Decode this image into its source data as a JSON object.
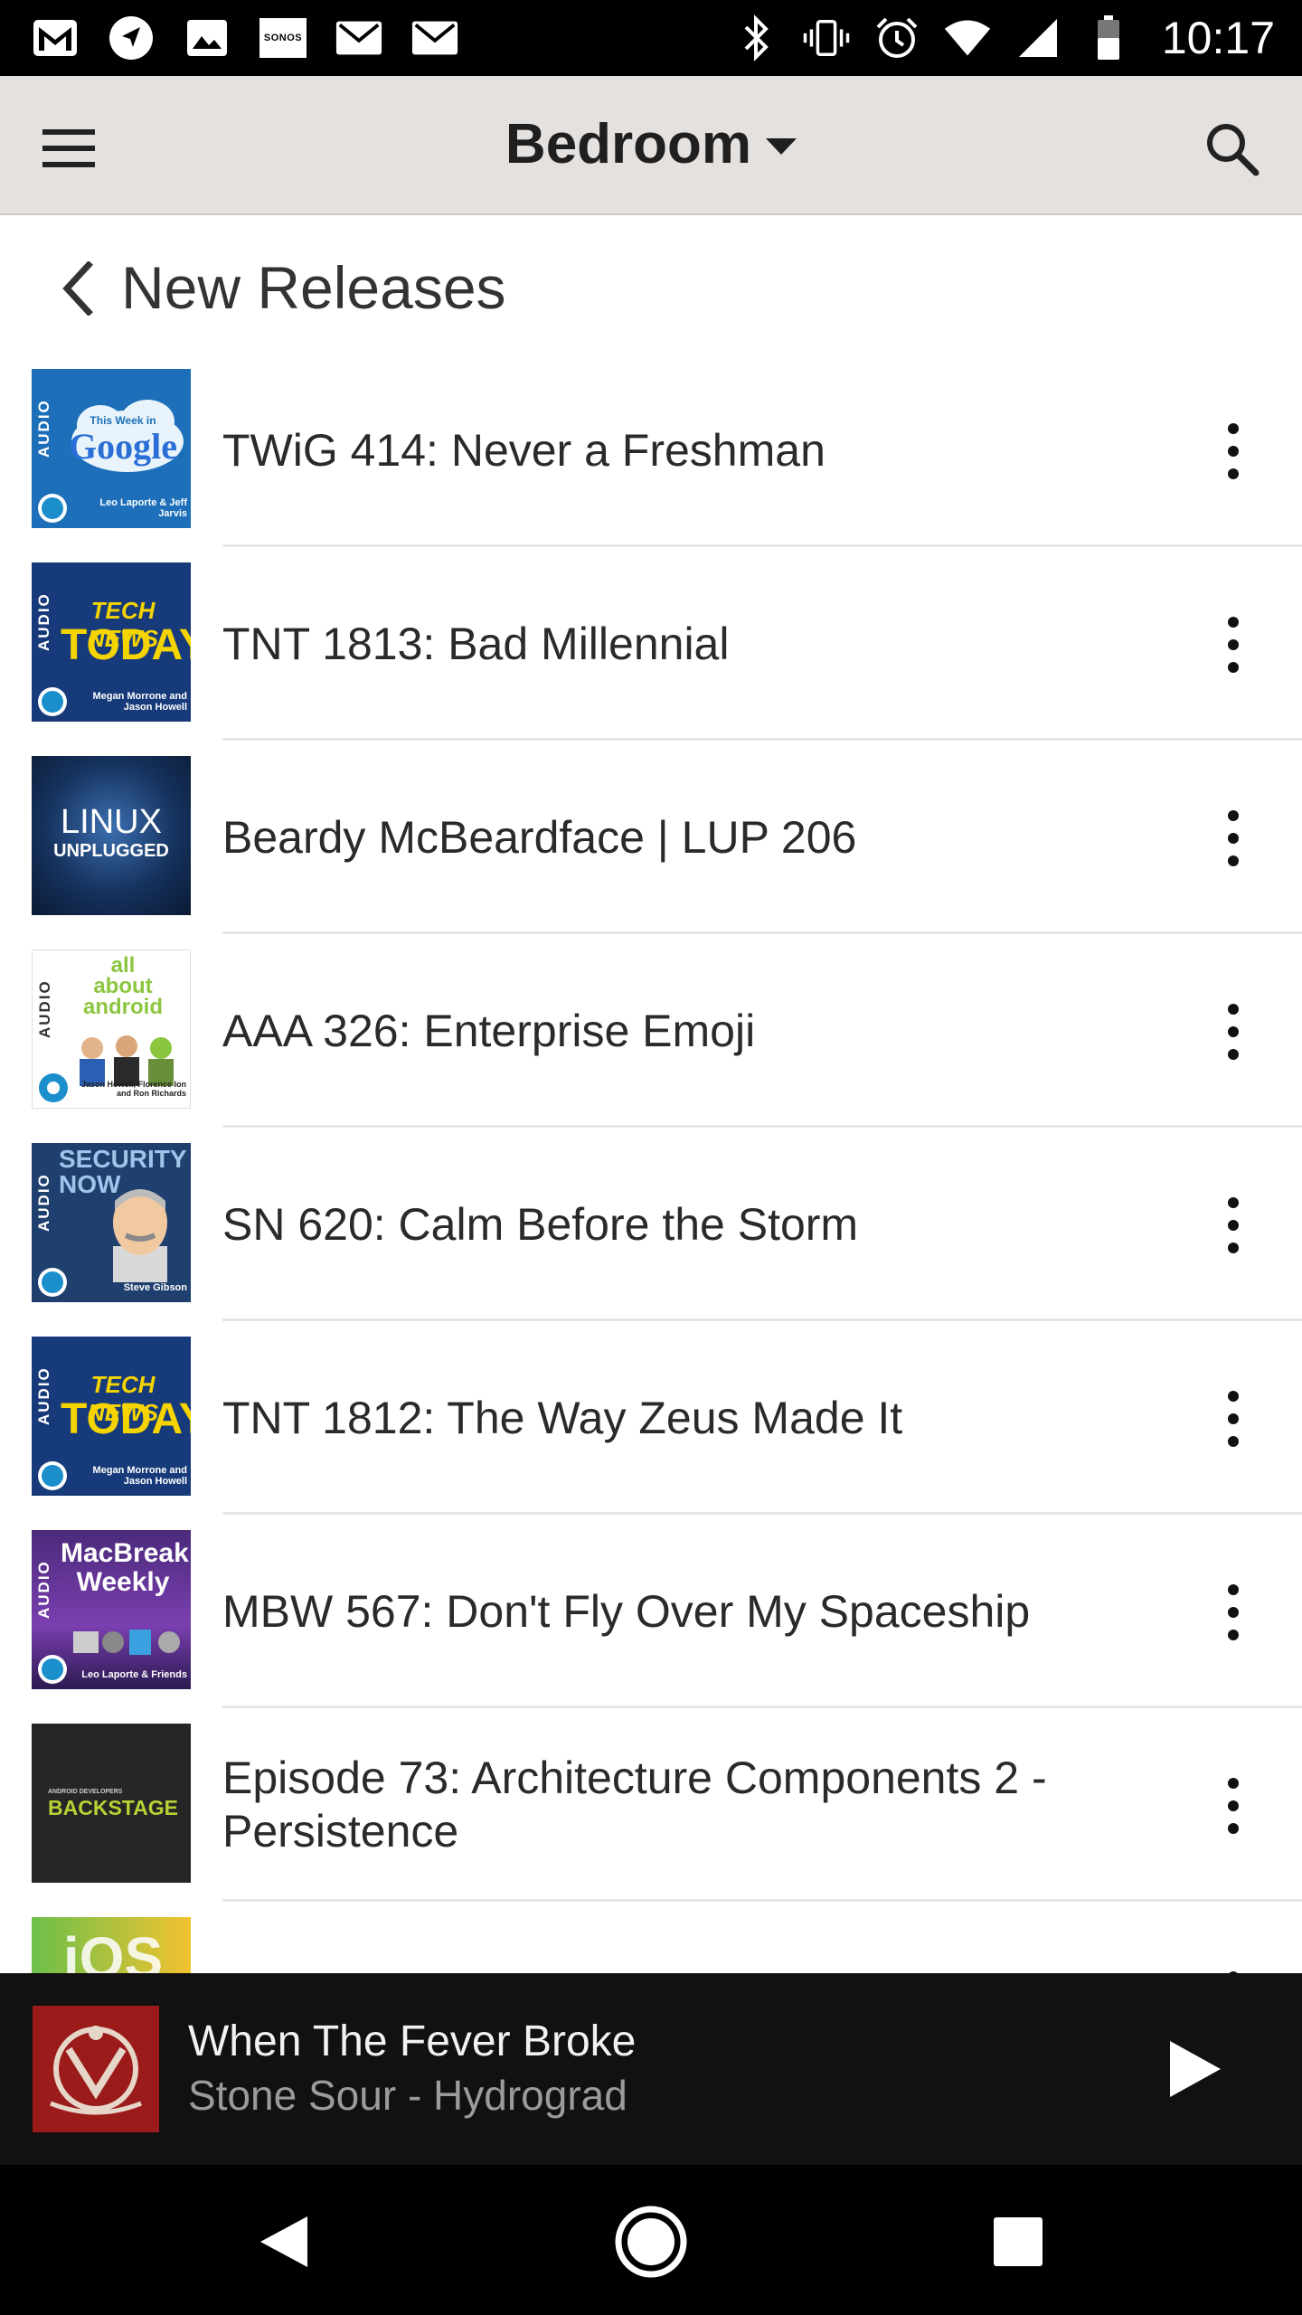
{
  "status_bar": {
    "time": "10:17",
    "left_icons": [
      "gmail-icon",
      "navigation-icon",
      "image-icon",
      "sonos-icon",
      "email-icon",
      "email-icon"
    ],
    "sonos_label": "SONOS",
    "right_icons": [
      "bluetooth-icon",
      "vibrate-icon",
      "alarm-icon",
      "wifi-icon",
      "signal-icon",
      "battery-icon"
    ]
  },
  "app_bar": {
    "room": "Bedroom",
    "menu_icon": "hamburger-menu-icon",
    "search_icon": "search-icon"
  },
  "section": {
    "title": "New Releases",
    "back_icon": "chevron-left-icon"
  },
  "episodes": [
    {
      "title": "TWiG 414: Never a Freshman",
      "art": "This Week in Google",
      "art_sub": "Leo Laporte & Jeff Jarvis"
    },
    {
      "title": "TNT 1813: Bad Millennial",
      "art": "TECH NEWS TODAY",
      "art_sub": "Megan Morrone and Jason Howell"
    },
    {
      "title": "Beardy McBeardface | LUP 206",
      "art": "LINUX UNPLUGGED",
      "art_sub": ""
    },
    {
      "title": "AAA 326: Enterprise Emoji",
      "art": "all about android",
      "art_sub": "Jason Howell, Florence Ion and Ron Richards"
    },
    {
      "title": "SN 620: Calm Before the Storm",
      "art": "SECURITY NOW",
      "art_sub": "Steve Gibson"
    },
    {
      "title": "TNT 1812: The Way Zeus Made It",
      "art": "TECH NEWS TODAY",
      "art_sub": "Megan Morrone and Jason Howell"
    },
    {
      "title": "MBW 567: Don't Fly Over My Spaceship",
      "art": "MacBreak Weekly",
      "art_sub": "Leo Laporte & Friends"
    },
    {
      "title": "Episode 73: Architecture Components 2 - Persistence",
      "art": "BACKSTAGE",
      "art_sub": "ANDROID DEVELOPERS"
    },
    {
      "title": "",
      "art": "iOS",
      "art_sub": ""
    }
  ],
  "art_audio_label": "AUDIO",
  "now_playing": {
    "track": "When The Fever Broke",
    "artist_album": "Stone Sour - Hydrograd",
    "play_icon": "play-icon"
  },
  "nav_bar": {
    "icons": [
      "back-triangle-icon",
      "home-circle-icon",
      "recents-square-icon"
    ]
  },
  "colors": {
    "app_bar_bg": "#e4e1df",
    "now_playing_bg": "#121010",
    "twit_blue": "#1a8fcc"
  }
}
